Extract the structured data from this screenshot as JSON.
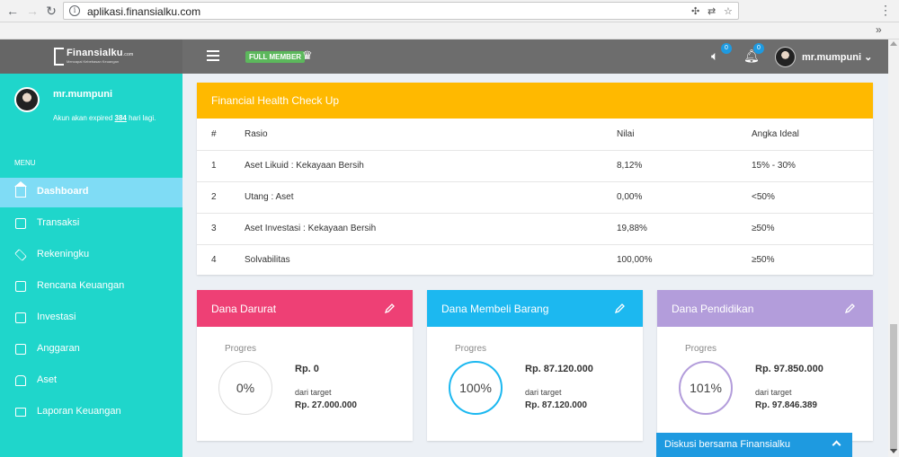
{
  "browser": {
    "url": "aplikasi.finansialku.com",
    "info_icon": "i",
    "bookmarks_more": "»"
  },
  "topbar": {
    "brand": "Finansialku",
    "brand_suffix": ".com",
    "brand_tagline": "Mencapai Kebebasan Keuangan",
    "member_badge": "FULL MEMBER",
    "notification_count_speaker": "0",
    "notification_count_bell": "0",
    "username": "mr.mumpuni",
    "user_caret": "⌄"
  },
  "sidebar": {
    "username": "mr.mumpuni",
    "expire_prefix": "Akun akan expired ",
    "expire_days": "384",
    "expire_suffix": " hari lagi.",
    "menu_title": "MENU",
    "items": [
      {
        "label": "Dashboard",
        "icon": "home-icon"
      },
      {
        "label": "Transaksi",
        "icon": "table-icon"
      },
      {
        "label": "Rekeningku",
        "icon": "layers-icon"
      },
      {
        "label": "Rencana Keuangan",
        "icon": "clipboard-icon"
      },
      {
        "label": "Investasi",
        "icon": "chart-icon"
      },
      {
        "label": "Anggaran",
        "icon": "calculator-icon"
      },
      {
        "label": "Aset",
        "icon": "car-icon"
      },
      {
        "label": "Laporan Keuangan",
        "icon": "folder-icon"
      }
    ]
  },
  "health": {
    "title": "Financial Health Check Up",
    "columns": [
      "#",
      "Rasio",
      "Nilai",
      "Angka Ideal"
    ],
    "rows": [
      [
        "1",
        "Aset Likuid : Kekayaan Bersih",
        "8,12%",
        "15% - 30%"
      ],
      [
        "2",
        "Utang : Aset",
        "0,00%",
        "<50%"
      ],
      [
        "3",
        "Aset Investasi : Kekayaan Bersih",
        "19,88%",
        "≥50%"
      ],
      [
        "4",
        "Solvabilitas",
        "100,00%",
        "≥50%"
      ]
    ]
  },
  "goals": [
    {
      "title": "Dana Darurat",
      "progress_label": "Progres",
      "percent": "0%",
      "amount": "Rp. 0",
      "target_label": "dari target",
      "target": "Rp. 27.000.000",
      "color": "#ee4075"
    },
    {
      "title": "Dana Membeli Barang",
      "progress_label": "Progres",
      "percent": "100%",
      "amount": "Rp. 87.120.000",
      "target_label": "dari target",
      "target": "Rp. 87.120.000",
      "color": "#1cb8f0"
    },
    {
      "title": "Dana Pendidikan",
      "progress_label": "Progres",
      "percent": "101%",
      "amount": "Rp. 97.850.000",
      "target_label": "dari target",
      "target": "Rp. 97.846.389",
      "color": "#b39ddb"
    }
  ],
  "chat": {
    "label": "Diskusi bersama Finansialku"
  },
  "colors": {
    "sidebar": "#1fd6cb",
    "sidebar_active": "#7fdcf5",
    "health_header": "#ffb900",
    "badge_green": "#5cb85c",
    "badge_blue": "#1e9ae0"
  }
}
